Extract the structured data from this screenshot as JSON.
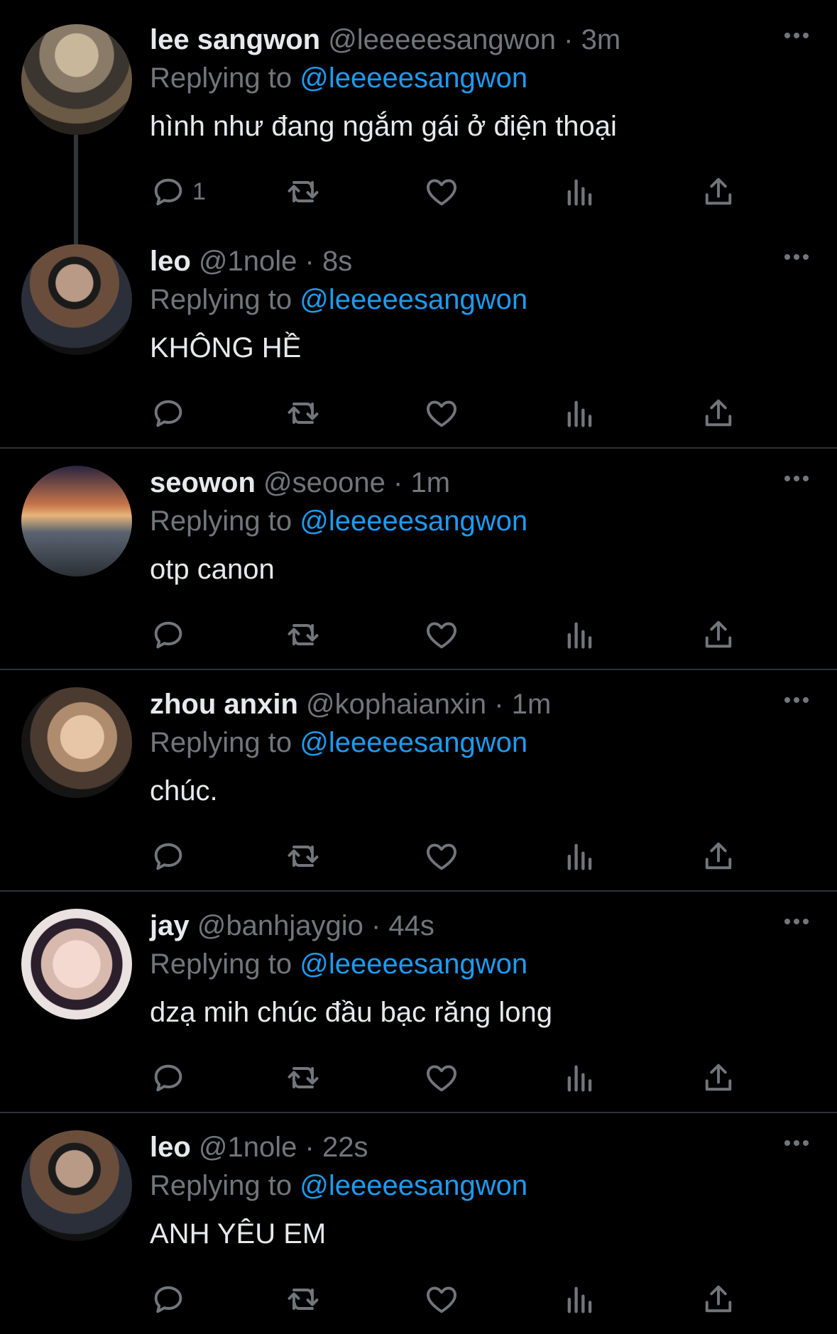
{
  "colors": {
    "background": "#000000",
    "text": "#e7e9ea",
    "muted": "#71767b",
    "link": "#1d9bf0",
    "divider": "#2f3336"
  },
  "reply_prefix": "Replying to",
  "tweets": [
    {
      "name": "lee sangwon",
      "handle": "@leeeeesangwon",
      "dot": "·",
      "time": "3m",
      "reply_to": "@leeeeesangwon",
      "text": "hình như đang ngắm gái ở điện thoại",
      "reply_count": "1"
    },
    {
      "name": "leo",
      "handle": "@1nole",
      "dot": "·",
      "time": "8s",
      "reply_to": "@leeeeesangwon",
      "text": "KHÔNG HỀ",
      "reply_count": ""
    },
    {
      "name": "seowon",
      "handle": "@seoone",
      "dot": "·",
      "time": "1m",
      "reply_to": "@leeeeesangwon",
      "text": "otp canon",
      "reply_count": ""
    },
    {
      "name": "zhou anxin",
      "handle": "@kophaianxin",
      "dot": "·",
      "time": "1m",
      "reply_to": "@leeeeesangwon",
      "text": "chúc.",
      "reply_count": ""
    },
    {
      "name": "jay",
      "handle": "@banhjaygio",
      "dot": "·",
      "time": "44s",
      "reply_to": "@leeeeesangwon",
      "text": "dzạ mih chúc đầu bạc răng long",
      "reply_count": ""
    },
    {
      "name": "leo",
      "handle": "@1nole",
      "dot": "·",
      "time": "22s",
      "reply_to": "@leeeeesangwon",
      "text": "ANH YÊU EM",
      "reply_count": ""
    }
  ]
}
